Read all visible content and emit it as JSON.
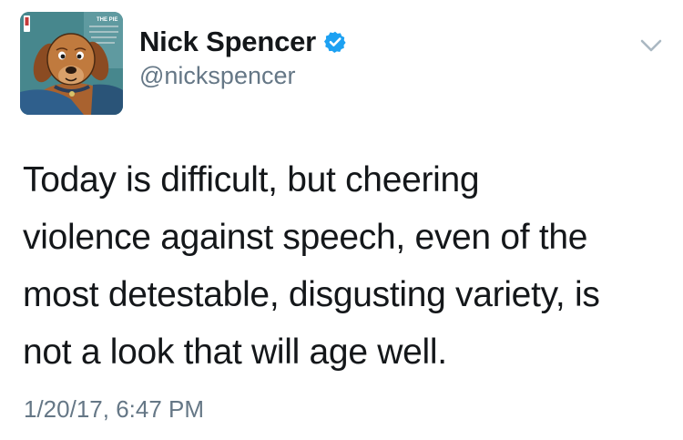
{
  "author": {
    "display_name": "Nick Spencer",
    "handle": "@nickspencer",
    "verified": true,
    "avatar_icon": "dog-comic-avatar",
    "avatar_badge_text": "THE PIE"
  },
  "tweet": {
    "text_lines": [
      "Today is difficult, but cheering",
      "violence against speech, even of the",
      "most detestable, disgusting variety, is",
      "not a look that will age well."
    ],
    "timestamp": "1/20/17, 6:47 PM"
  },
  "colors": {
    "text": "#14171a",
    "secondary": "#657786",
    "verified_blue": "#1da1f2",
    "chevron": "#aab8c2"
  },
  "icons": {
    "verified": "verified-badge-icon",
    "menu": "chevron-down-icon"
  }
}
